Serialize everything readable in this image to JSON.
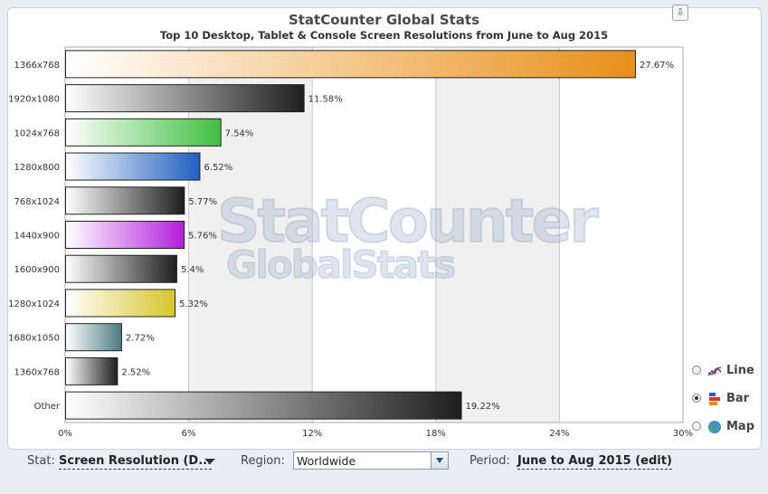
{
  "title": "StatCounter Global Stats",
  "subtitle": "Top 10 Desktop, Tablet & Console Screen Resolutions from June to Aug 2015",
  "watermark": {
    "line1": "StatCounter",
    "line2": "GlobalStats"
  },
  "download_icon": "download-icon",
  "chart_data": {
    "type": "bar",
    "orientation": "horizontal",
    "title": "StatCounter Global Stats",
    "subtitle": "Top 10 Desktop, Tablet & Console Screen Resolutions from June to Aug 2015",
    "categories": [
      "1366x768",
      "1920x1080",
      "1024x768",
      "1280x800",
      "768x1024",
      "1440x900",
      "1600x900",
      "1280x1024",
      "1680x1050",
      "1360x768",
      "Other"
    ],
    "values": [
      27.67,
      11.58,
      7.54,
      6.52,
      5.77,
      5.76,
      5.4,
      5.32,
      2.72,
      2.52,
      19.22
    ],
    "value_labels": [
      "27.67%",
      "11.58%",
      "7.54%",
      "6.52%",
      "5.77%",
      "5.76%",
      "5.4%",
      "5.32%",
      "2.72%",
      "2.52%",
      "19.22%"
    ],
    "colors": [
      "#e8901a",
      "#1e1e1e",
      "#3fbf3f",
      "#1e5fbf",
      "#1e1e1e",
      "#b21fdc",
      "#1e1e1e",
      "#d6c62a",
      "#4a7a80",
      "#1e1e1e",
      "#1e1e1e"
    ],
    "xlim": [
      0,
      30
    ],
    "xticks": [
      "0%",
      "6%",
      "12%",
      "18%",
      "24%",
      "30%"
    ],
    "grid": true,
    "legend": "none"
  },
  "chart_types": [
    {
      "label": "Line",
      "selected": false,
      "icon": "line-chart-icon"
    },
    {
      "label": "Bar",
      "selected": true,
      "icon": "bar-chart-icon"
    },
    {
      "label": "Map",
      "selected": false,
      "icon": "globe-icon"
    }
  ],
  "controls": {
    "stat_label": "Stat:",
    "stat_value": "Screen Resolution (D...",
    "region_label": "Region:",
    "region_value": "Worldwide",
    "period_label": "Period:",
    "period_value": "June to Aug 2015 (edit)"
  }
}
